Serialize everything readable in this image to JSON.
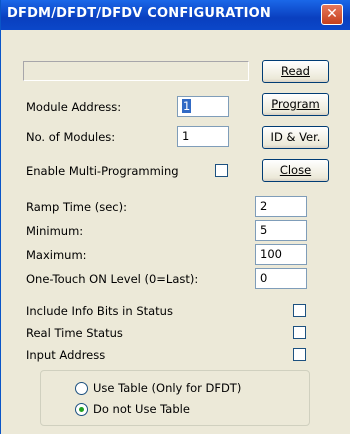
{
  "window": {
    "title": "DFDM/DFDT/DFDV CONFIGURATION",
    "close_glyph": "✕"
  },
  "status_field": {
    "value": ""
  },
  "buttons": {
    "read": {
      "label": "Read"
    },
    "program": {
      "label": "Program"
    },
    "id_ver": {
      "label": "ID & Ver."
    },
    "close": {
      "label": "Close"
    }
  },
  "module": {
    "address_label": "Module Address:",
    "address_value": "1",
    "count_label": "No. of Modules:",
    "count_value": "1",
    "multi_label": "Enable Multi-Programming",
    "multi_checked": false
  },
  "params": [
    {
      "label": "Ramp Time (sec):",
      "value": "2"
    },
    {
      "label": "Minimum:",
      "value": "5"
    },
    {
      "label": "Maximum:",
      "value": "100"
    },
    {
      "label": "One-Touch ON Level (0=Last):",
      "value": "0"
    }
  ],
  "options": [
    {
      "label": "Include Info Bits in Status",
      "checked": false
    },
    {
      "label": "Real Time Status",
      "checked": false
    },
    {
      "label": "Input Address",
      "checked": false
    }
  ],
  "table_group": {
    "options": [
      {
        "label": "Use Table (Only for DFDT)",
        "selected": false
      },
      {
        "label": "Do not Use Table",
        "selected": true
      }
    ]
  },
  "colors": {
    "accent": "#0a3fbf",
    "selection": "#316ac5",
    "radio_dot": "#21a121"
  }
}
